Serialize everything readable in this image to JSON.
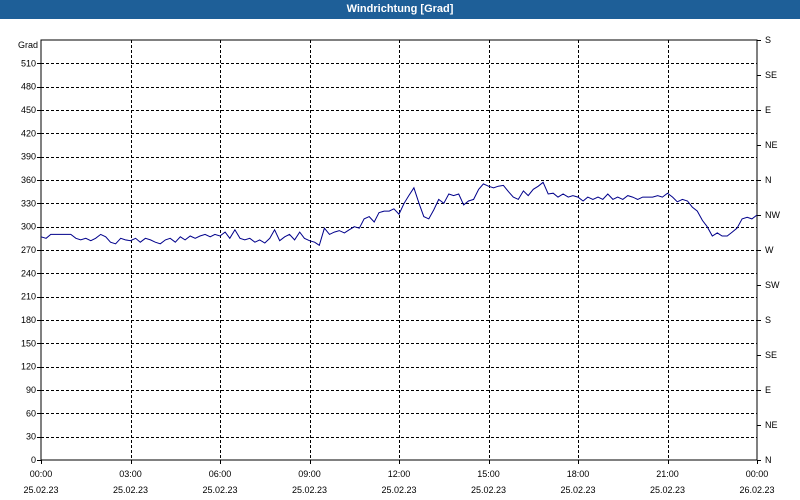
{
  "window": {
    "title": "Windrichtung [Grad]"
  },
  "chart_data": {
    "type": "line",
    "title": "Windrichtung [Grad]",
    "ylabel": "Grad",
    "ylim": [
      0,
      540
    ],
    "yticks": [
      0,
      30,
      60,
      90,
      120,
      150,
      180,
      210,
      240,
      270,
      300,
      330,
      360,
      390,
      420,
      450,
      480,
      510
    ],
    "right_axis_labels": [
      {
        "value": 540,
        "label": "S"
      },
      {
        "value": 495,
        "label": "SE"
      },
      {
        "value": 450,
        "label": "E"
      },
      {
        "value": 405,
        "label": "NE"
      },
      {
        "value": 360,
        "label": "N"
      },
      {
        "value": 315,
        "label": "NW"
      },
      {
        "value": 270,
        "label": "W"
      },
      {
        "value": 225,
        "label": "SW"
      },
      {
        "value": 180,
        "label": "S"
      },
      {
        "value": 135,
        "label": "SE"
      },
      {
        "value": 90,
        "label": "E"
      },
      {
        "value": 45,
        "label": "NE"
      },
      {
        "value": 0,
        "label": "N"
      }
    ],
    "xlim": [
      0,
      24
    ],
    "xticks": [
      {
        "hour": 0,
        "time": "00:00",
        "date": "25.02.23"
      },
      {
        "hour": 3,
        "time": "03:00",
        "date": "25.02.23"
      },
      {
        "hour": 6,
        "time": "06:00",
        "date": "25.02.23"
      },
      {
        "hour": 9,
        "time": "09:00",
        "date": "25.02.23"
      },
      {
        "hour": 12,
        "time": "12:00",
        "date": "25.02.23"
      },
      {
        "hour": 15,
        "time": "15:00",
        "date": "25.02.23"
      },
      {
        "hour": 18,
        "time": "18:00",
        "date": "25.02.23"
      },
      {
        "hour": 21,
        "time": "21:00",
        "date": "25.02.23"
      },
      {
        "hour": 24,
        "time": "00:00",
        "date": "26.02.23"
      }
    ],
    "grid": true,
    "series": [
      {
        "color": "#00008b",
        "points": [
          [
            0.0,
            287
          ],
          [
            0.17,
            285
          ],
          [
            0.33,
            290
          ],
          [
            0.67,
            290
          ],
          [
            1.0,
            290
          ],
          [
            1.17,
            285
          ],
          [
            1.33,
            283
          ],
          [
            1.5,
            285
          ],
          [
            1.67,
            282
          ],
          [
            1.83,
            285
          ],
          [
            2.0,
            290
          ],
          [
            2.17,
            287
          ],
          [
            2.33,
            280
          ],
          [
            2.5,
            278
          ],
          [
            2.67,
            285
          ],
          [
            2.83,
            283
          ],
          [
            3.0,
            282
          ],
          [
            3.17,
            285
          ],
          [
            3.33,
            280
          ],
          [
            3.5,
            285
          ],
          [
            3.67,
            283
          ],
          [
            3.83,
            280
          ],
          [
            4.0,
            278
          ],
          [
            4.17,
            283
          ],
          [
            4.33,
            285
          ],
          [
            4.5,
            280
          ],
          [
            4.67,
            287
          ],
          [
            4.83,
            283
          ],
          [
            5.0,
            288
          ],
          [
            5.17,
            285
          ],
          [
            5.33,
            288
          ],
          [
            5.5,
            290
          ],
          [
            5.67,
            287
          ],
          [
            5.83,
            290
          ],
          [
            6.0,
            288
          ],
          [
            6.17,
            293
          ],
          [
            6.33,
            285
          ],
          [
            6.5,
            296
          ],
          [
            6.67,
            285
          ],
          [
            6.83,
            283
          ],
          [
            7.0,
            285
          ],
          [
            7.17,
            280
          ],
          [
            7.33,
            283
          ],
          [
            7.5,
            279
          ],
          [
            7.67,
            285
          ],
          [
            7.83,
            296
          ],
          [
            8.0,
            282
          ],
          [
            8.17,
            287
          ],
          [
            8.33,
            290
          ],
          [
            8.5,
            283
          ],
          [
            8.67,
            293
          ],
          [
            8.83,
            285
          ],
          [
            9.0,
            282
          ],
          [
            9.17,
            280
          ],
          [
            9.33,
            276
          ],
          [
            9.5,
            298
          ],
          [
            9.67,
            290
          ],
          [
            9.83,
            293
          ],
          [
            10.0,
            295
          ],
          [
            10.17,
            292
          ],
          [
            10.33,
            296
          ],
          [
            10.5,
            300
          ],
          [
            10.67,
            298
          ],
          [
            10.83,
            310
          ],
          [
            11.0,
            313
          ],
          [
            11.17,
            306
          ],
          [
            11.33,
            318
          ],
          [
            11.5,
            320
          ],
          [
            11.67,
            320
          ],
          [
            11.83,
            323
          ],
          [
            12.0,
            316
          ],
          [
            12.17,
            330
          ],
          [
            12.33,
            340
          ],
          [
            12.5,
            350
          ],
          [
            12.67,
            330
          ],
          [
            12.83,
            313
          ],
          [
            13.0,
            310
          ],
          [
            13.17,
            322
          ],
          [
            13.33,
            335
          ],
          [
            13.5,
            330
          ],
          [
            13.67,
            342
          ],
          [
            13.83,
            340
          ],
          [
            14.0,
            342
          ],
          [
            14.17,
            328
          ],
          [
            14.33,
            333
          ],
          [
            14.5,
            335
          ],
          [
            14.67,
            348
          ],
          [
            14.83,
            355
          ],
          [
            15.0,
            352
          ],
          [
            15.17,
            350
          ],
          [
            15.33,
            352
          ],
          [
            15.5,
            353
          ],
          [
            15.67,
            345
          ],
          [
            15.83,
            338
          ],
          [
            16.0,
            335
          ],
          [
            16.17,
            346
          ],
          [
            16.33,
            340
          ],
          [
            16.5,
            348
          ],
          [
            16.67,
            352
          ],
          [
            16.83,
            357
          ],
          [
            17.0,
            342
          ],
          [
            17.17,
            343
          ],
          [
            17.33,
            338
          ],
          [
            17.5,
            342
          ],
          [
            17.67,
            338
          ],
          [
            17.83,
            340
          ],
          [
            18.0,
            338
          ],
          [
            18.17,
            333
          ],
          [
            18.33,
            338
          ],
          [
            18.5,
            335
          ],
          [
            18.67,
            338
          ],
          [
            18.83,
            335
          ],
          [
            19.0,
            342
          ],
          [
            19.17,
            335
          ],
          [
            19.33,
            338
          ],
          [
            19.5,
            335
          ],
          [
            19.67,
            340
          ],
          [
            19.83,
            338
          ],
          [
            20.0,
            335
          ],
          [
            20.17,
            338
          ],
          [
            20.33,
            338
          ],
          [
            20.5,
            338
          ],
          [
            20.67,
            340
          ],
          [
            20.83,
            338
          ],
          [
            21.0,
            343
          ],
          [
            21.17,
            338
          ],
          [
            21.33,
            332
          ],
          [
            21.5,
            335
          ],
          [
            21.67,
            333
          ],
          [
            21.83,
            325
          ],
          [
            22.0,
            320
          ],
          [
            22.17,
            308
          ],
          [
            22.33,
            300
          ],
          [
            22.5,
            288
          ],
          [
            22.67,
            292
          ],
          [
            22.83,
            288
          ],
          [
            23.0,
            288
          ],
          [
            23.17,
            293
          ],
          [
            23.33,
            298
          ],
          [
            23.5,
            310
          ],
          [
            23.67,
            312
          ],
          [
            23.83,
            310
          ],
          [
            24.0,
            315
          ]
        ]
      }
    ]
  }
}
